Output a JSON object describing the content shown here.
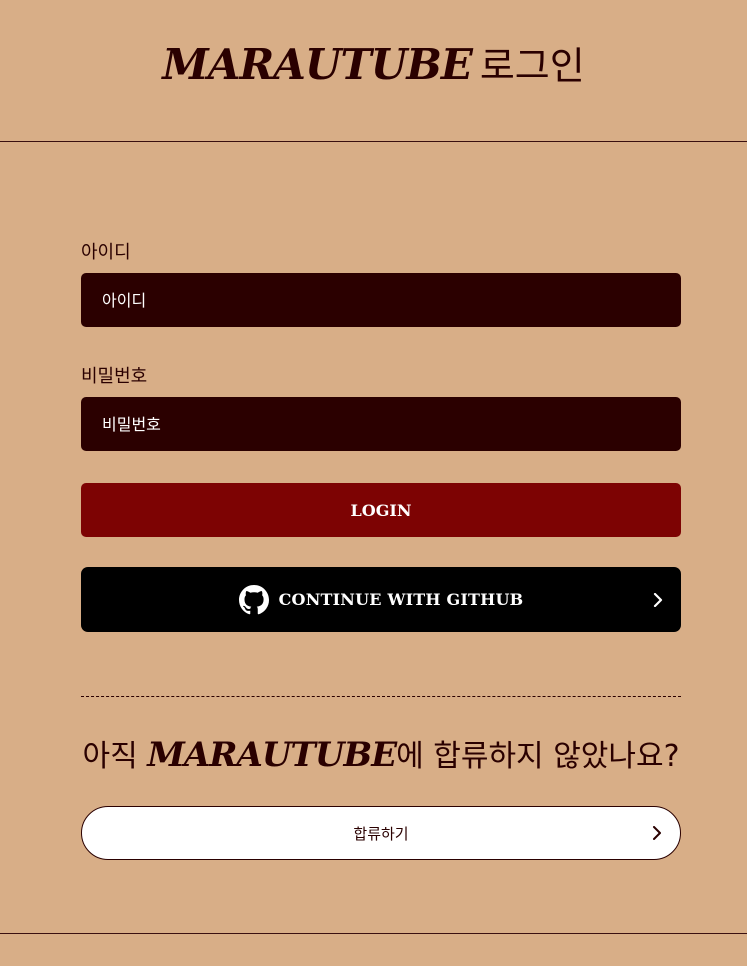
{
  "header": {
    "brand": "MARAUTUBE",
    "title_suffix": "로그인"
  },
  "form": {
    "username": {
      "label": "아이디",
      "placeholder": "아이디",
      "value": ""
    },
    "password": {
      "label": "비밀번호",
      "placeholder": "비밀번호",
      "value": ""
    },
    "login_label": "LOGIN",
    "github": {
      "label": "CONTINUE WITH GITHUB",
      "icon": "github-icon",
      "arrow_icon": "chevron-right-icon"
    }
  },
  "join": {
    "prefix": "아직",
    "brand": "MARAUTUBE",
    "suffix": "에 합류하지 않았나요?",
    "button_label": "합류하기",
    "arrow_icon": "chevron-right-icon"
  },
  "colors": {
    "background": "#d8ae87",
    "input_bg": "#2b0000",
    "login_bg": "#7d0303",
    "github_bg": "#000000",
    "text": "#2a0000"
  }
}
